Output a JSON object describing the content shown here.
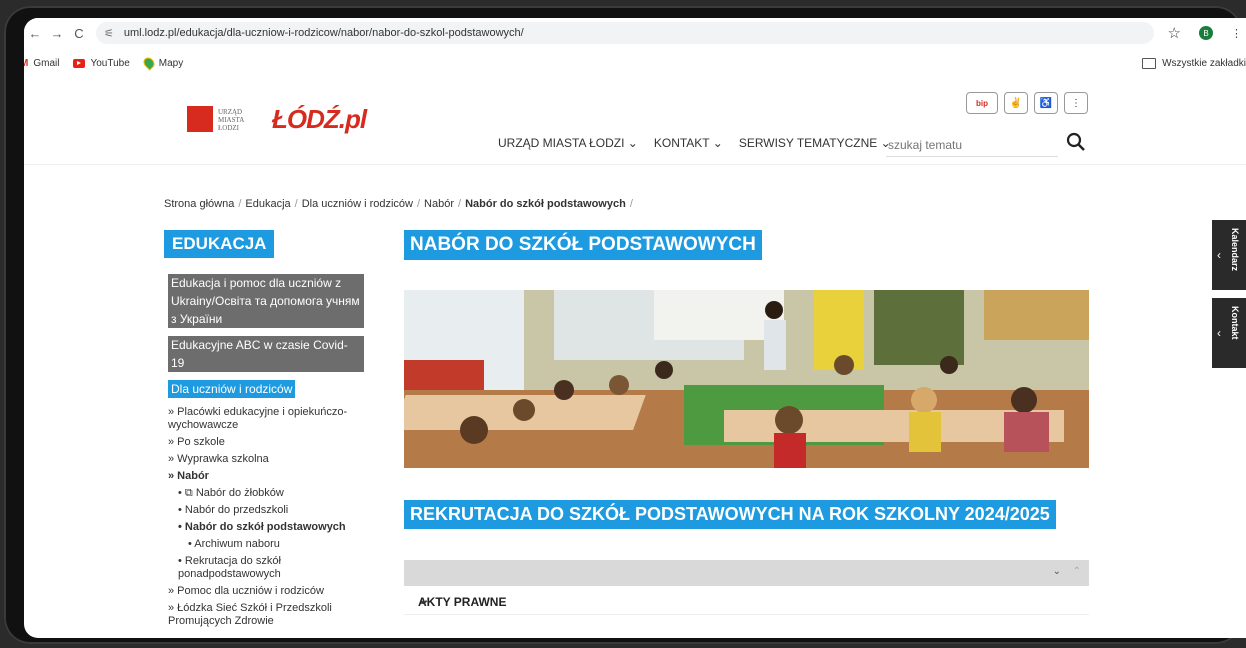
{
  "browser": {
    "url": "uml.lodz.pl/edukacja/dla-uczniow-i-rodzicow/nabor/nabor-do-szkol-podstawowych/",
    "profile_initial": "B",
    "bookmarks": [
      "Gmail",
      "YouTube",
      "Mapy"
    ],
    "all_bookmarks": "Wszystkie zakładki"
  },
  "header": {
    "logo_text": [
      "URZĄD",
      "MIASTA",
      "ŁODZI"
    ],
    "brand": "ŁÓDŹ",
    "brand_suffix": ".pl",
    "bip_label": "bip",
    "nav": [
      "URZĄD MIASTA ŁODZI ⌄",
      "KONTAKT ⌄",
      "SERWISY TEMATYCZNE ⌄"
    ],
    "search_placeholder": "szukaj tematu"
  },
  "breadcrumb": [
    "Strona główna",
    "Edukacja",
    "Dla uczniów i rodziców",
    "Nabór",
    "Nabór do szkół podstawowych"
  ],
  "sidebar": {
    "title": "EDUKACJA",
    "block1": "Edukacja i pomoc dla uczniów z Ukrainy/Освіта та допомога учням з України",
    "block2": "Edukacyjne ABC w czasie Covid-19",
    "active": "Dla uczniów i rodziców",
    "items": [
      "» Placówki edukacyjne i opiekuńczo-wychowawcze",
      "» Po szkole",
      "» Wyprawka szkolna",
      "» Nabór",
      "• ⧉ Nabór do żłobków",
      "• Nabór do przedszkoli",
      "• Nabór do szkół podstawowych",
      "• Archiwum naboru",
      "• Rekrutacja do szkół ponadpodstawowych",
      "» Pomoc dla uczniów i rodziców",
      "» Łódzka Sieć Szkół i Przedszkoli Promujących Zdrowie"
    ]
  },
  "content": {
    "title": "NABÓR DO SZKÓŁ PODSTAWOWYCH",
    "subtitle": "REKRUTACJA DO SZKÓŁ PODSTAWOWYCH NA ROK SZKOLNY 2024/2025",
    "accordion_label": "AKTY PRAWNE"
  },
  "side_tabs": [
    "Kalendarz",
    "Kontakt"
  ]
}
